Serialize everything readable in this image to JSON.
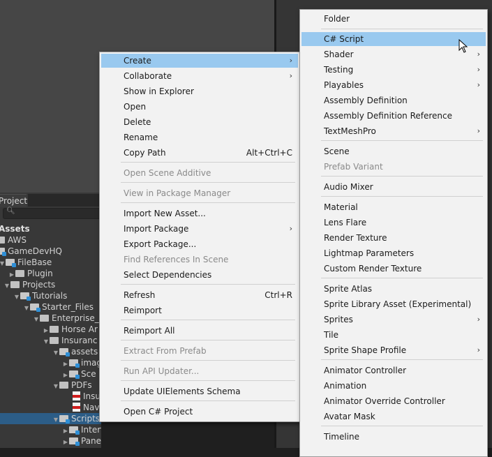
{
  "project_panel": {
    "tab_label": "Project",
    "search_icon": "search-icon",
    "tree": [
      {
        "label": "Assets",
        "bold": true,
        "icon": "none"
      },
      {
        "label": "AWS",
        "icon": "folder"
      },
      {
        "label": "GameDevHQ",
        "icon": "folder-blue"
      },
      {
        "label": "FileBase",
        "icon": "folder-blue"
      },
      {
        "label": "Plugin",
        "icon": "folder"
      },
      {
        "label": "Projects",
        "icon": "folder"
      },
      {
        "label": "Tutorials",
        "icon": "folder-blue"
      },
      {
        "label": "Starter_Files",
        "icon": "folder-blue"
      },
      {
        "label": "Enterprise_A",
        "icon": "folder"
      },
      {
        "label": "Horse Ar",
        "icon": "folder"
      },
      {
        "label": "Insuranc",
        "icon": "folder"
      },
      {
        "label": "assets",
        "icon": "folder-blue"
      },
      {
        "label": "imag",
        "icon": "folder-blue"
      },
      {
        "label": "Sce",
        "icon": "folder-blue"
      },
      {
        "label": "PDFs",
        "icon": "folder"
      },
      {
        "label": "Insu",
        "icon": "pdf"
      },
      {
        "label": "Nav",
        "icon": "pdf"
      },
      {
        "label": "Scripts",
        "icon": "folder-blue",
        "selected": true
      },
      {
        "label": "Interface",
        "icon": "folder-blue"
      },
      {
        "label": "Panels",
        "icon": "folder-blue"
      }
    ]
  },
  "main_menu": {
    "items": [
      {
        "label": "Create",
        "submenu": true,
        "highlighted": true
      },
      {
        "label": "Collaborate",
        "submenu": true
      },
      {
        "label": "Show in Explorer"
      },
      {
        "label": "Open"
      },
      {
        "label": "Delete"
      },
      {
        "label": "Rename"
      },
      {
        "label": "Copy Path",
        "shortcut": "Alt+Ctrl+C"
      },
      {
        "label": "Open Scene Additive",
        "disabled": true
      },
      {
        "label": "View in Package Manager",
        "disabled": true
      },
      {
        "label": "Import New Asset..."
      },
      {
        "label": "Import Package",
        "submenu": true
      },
      {
        "label": "Export Package..."
      },
      {
        "label": "Find References In Scene",
        "disabled": true
      },
      {
        "label": "Select Dependencies"
      },
      {
        "label": "Refresh",
        "shortcut": "Ctrl+R"
      },
      {
        "label": "Reimport"
      },
      {
        "label": "Reimport All"
      },
      {
        "label": "Extract From Prefab",
        "disabled": true
      },
      {
        "label": "Run API Updater...",
        "disabled": true
      },
      {
        "label": "Update UIElements Schema"
      },
      {
        "label": "Open C# Project"
      }
    ]
  },
  "create_submenu": {
    "items": [
      {
        "label": "Folder"
      },
      {
        "label": "C# Script",
        "highlighted": true
      },
      {
        "label": "Shader",
        "submenu": true
      },
      {
        "label": "Testing",
        "submenu": true
      },
      {
        "label": "Playables",
        "submenu": true
      },
      {
        "label": "Assembly Definition"
      },
      {
        "label": "Assembly Definition Reference"
      },
      {
        "label": "TextMeshPro",
        "submenu": true
      },
      {
        "label": "Scene"
      },
      {
        "label": "Prefab Variant",
        "disabled": true
      },
      {
        "label": "Audio Mixer"
      },
      {
        "label": "Material"
      },
      {
        "label": "Lens Flare"
      },
      {
        "label": "Render Texture"
      },
      {
        "label": "Lightmap Parameters"
      },
      {
        "label": "Custom Render Texture"
      },
      {
        "label": "Sprite Atlas"
      },
      {
        "label": "Sprite Library Asset (Experimental)"
      },
      {
        "label": "Sprites",
        "submenu": true
      },
      {
        "label": "Tile"
      },
      {
        "label": "Sprite Shape Profile",
        "submenu": true
      },
      {
        "label": "Animator Controller"
      },
      {
        "label": "Animation"
      },
      {
        "label": "Animator Override Controller"
      },
      {
        "label": "Avatar Mask"
      },
      {
        "label": "Timeline"
      }
    ]
  },
  "icons": {
    "submenu_arrow": "chevron-right-icon",
    "cursor": "mouse-pointer-icon"
  },
  "colors": {
    "highlight": "#99c9ef",
    "menu_bg": "#f2f2f2",
    "selection": "#2c5d87"
  }
}
